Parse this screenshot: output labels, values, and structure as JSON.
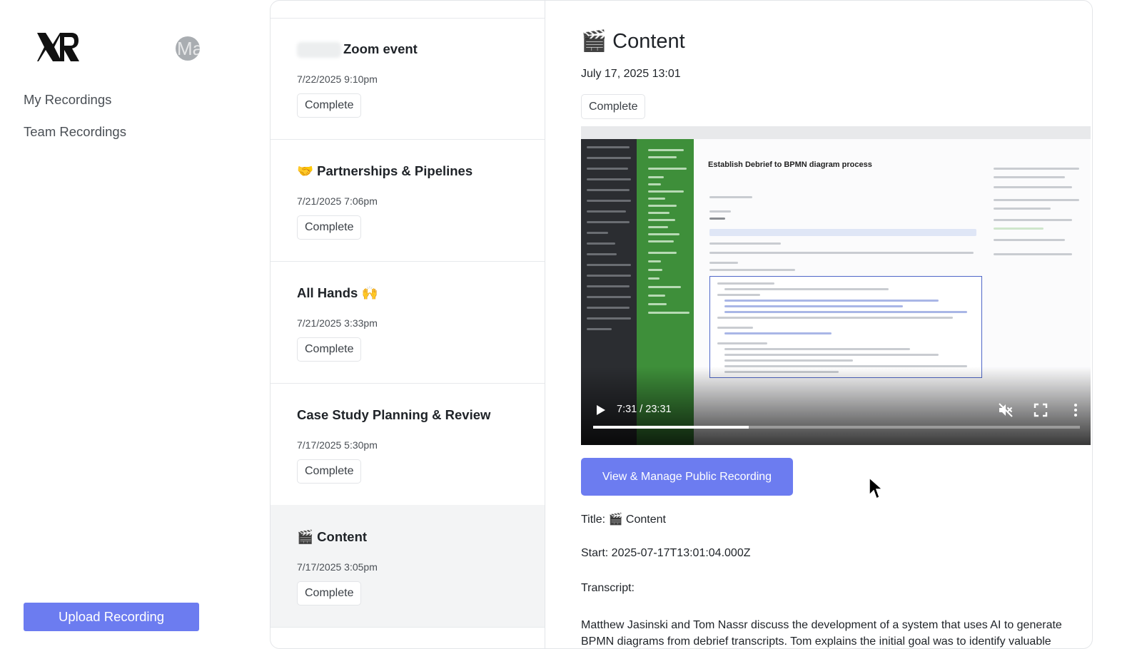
{
  "sidebar": {
    "logo_text": "XR",
    "avatar_text": "Ma",
    "nav": [
      {
        "label": "My Recordings"
      },
      {
        "label": "Team Recordings"
      }
    ],
    "upload_label": "Upload Recording"
  },
  "recordings": [
    {
      "title": "Zoom event",
      "date": "7/22/2025 9:10pm",
      "status": "Complete"
    },
    {
      "title": "🤝 Partnerships & Pipelines",
      "date": "7/21/2025 7:06pm",
      "status": "Complete"
    },
    {
      "title": "All Hands 🙌",
      "date": "7/21/2025 3:33pm",
      "status": "Complete"
    },
    {
      "title": "Case Study Planning & Review",
      "date": "7/17/2025 5:30pm",
      "status": "Complete"
    },
    {
      "title": "🎬 Content",
      "date": "7/17/2025 3:05pm",
      "status": "Complete"
    }
  ],
  "detail": {
    "title": "🎬 Content",
    "date": "July 17, 2025 13:01",
    "status": "Complete",
    "video": {
      "time": "7:31 / 23:31",
      "progress": 0.32,
      "screen_doc_title": "Establish Debrief to BPMN diagram process"
    },
    "manage_label": "View & Manage Public Recording",
    "title_line": "Title: 🎬 Content",
    "start_line": "Start: 2025-07-17T13:01:04.000Z",
    "transcript_label": "Transcript:",
    "transcript_text": "Matthew Jasinski and Tom Nassr discuss the development of a system that uses AI to generate BPMN diagrams from debrief transcripts. Tom explains the initial goal was to identify valuable"
  },
  "colors": {
    "accent": "#6c7cf0",
    "selected_row": "#f3f4f5",
    "border": "#e3e5e8"
  }
}
